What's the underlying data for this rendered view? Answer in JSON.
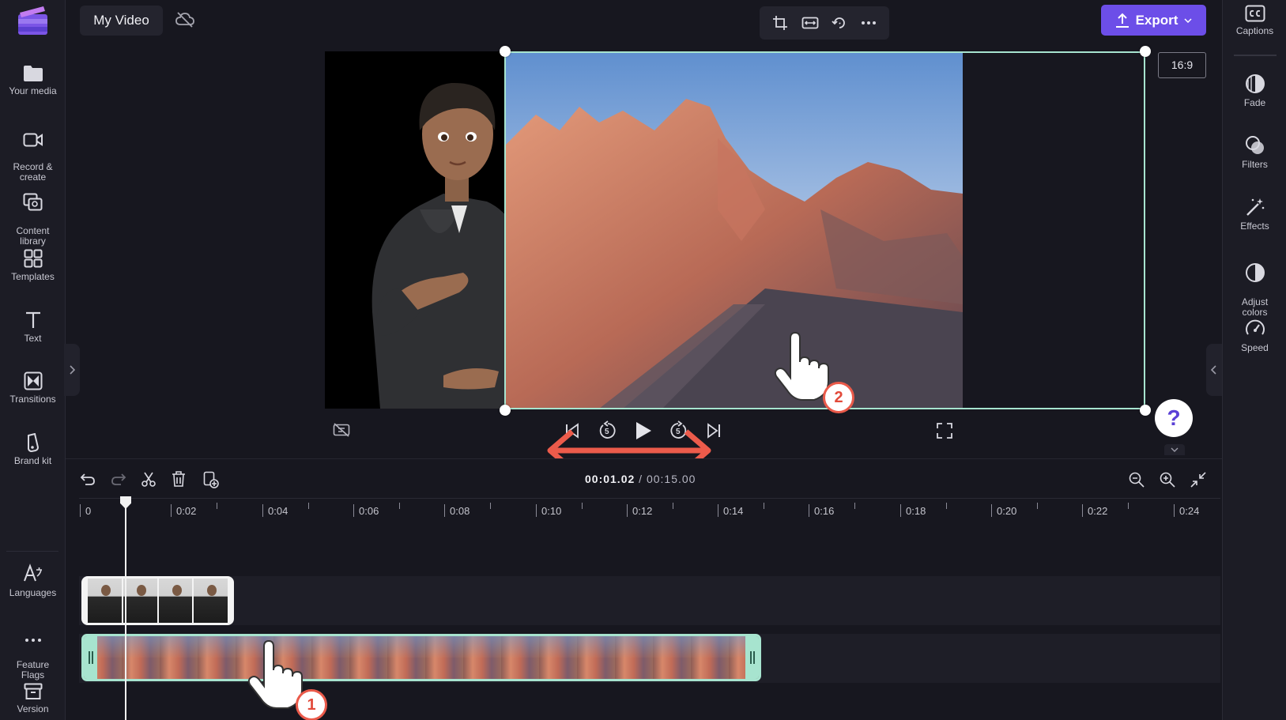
{
  "app": {
    "project_title": "My Video",
    "export_label": "Export",
    "aspect_ratio": "16:9",
    "accent_color": "#6c4ee8",
    "selection_color": "#a7e4cf"
  },
  "left_rail": {
    "items": [
      {
        "label": "Your media",
        "icon": "folder-icon"
      },
      {
        "label": "Record &\ncreate",
        "icon": "camera-icon"
      },
      {
        "label": "Content\nlibrary",
        "icon": "library-icon"
      },
      {
        "label": "Templates",
        "icon": "templates-icon"
      },
      {
        "label": "Text",
        "icon": "text-icon"
      },
      {
        "label": "Transitions",
        "icon": "transitions-icon"
      },
      {
        "label": "Brand kit",
        "icon": "brand-kit-icon"
      },
      {
        "label": "Languages",
        "icon": "languages-icon"
      },
      {
        "label": "Feature\nFlags",
        "icon": "more-icon"
      },
      {
        "label": "Version",
        "icon": "archive-icon"
      }
    ]
  },
  "right_rail": {
    "items": [
      {
        "label": "Captions",
        "icon": "captions-icon"
      },
      {
        "label": "Fade",
        "icon": "fade-icon"
      },
      {
        "label": "Filters",
        "icon": "filters-icon"
      },
      {
        "label": "Effects",
        "icon": "effects-icon"
      },
      {
        "label": "Adjust\ncolors",
        "icon": "adjust-colors-icon"
      },
      {
        "label": "Speed",
        "icon": "speed-icon"
      }
    ]
  },
  "playback": {
    "current_time": "00:01.02",
    "separator": " / ",
    "total_time": "00:15.00",
    "skip_back": "5",
    "skip_forward": "5"
  },
  "help": {
    "label": "?"
  },
  "timeline": {
    "ruler_labels": [
      "0",
      "0:02",
      "0:04",
      "0:06",
      "0:08",
      "0:10",
      "0:12",
      "0:14",
      "0:16",
      "0:18",
      "0:20",
      "0:22",
      "0:24"
    ],
    "playhead_seconds": 1.02
  },
  "annotations": {
    "step1": "1",
    "step2": "2"
  }
}
